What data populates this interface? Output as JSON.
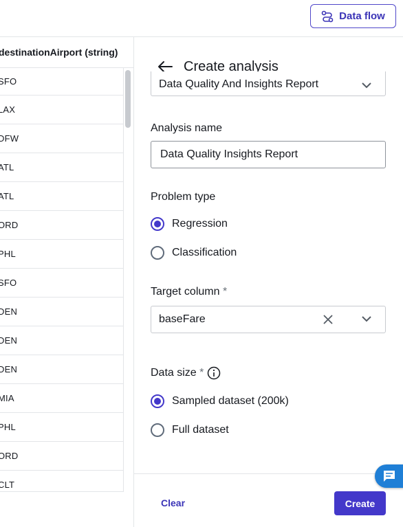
{
  "header": {
    "data_flow_label": "Data flow"
  },
  "table": {
    "column_header": "destinationAirport (string)",
    "rows": [
      "SFO",
      "LAX",
      "DFW",
      "ATL",
      "ATL",
      "ORD",
      "PHL",
      "SFO",
      "DEN",
      "DEN",
      "DEN",
      "MIA",
      "PHL",
      "ORD",
      "CLT"
    ]
  },
  "panel": {
    "title": "Create analysis",
    "analysis_type_value": "Data Quality And Insights Report",
    "analysis_name_label": "Analysis name",
    "analysis_name_value": "Data Quality Insights Report",
    "problem_type_label": "Problem type",
    "problem_type_options": [
      "Regression",
      "Classification"
    ],
    "problem_type_selected": "Regression",
    "target_column_label": "Target column",
    "target_column_value": "baseFare",
    "data_size_label": "Data size",
    "data_size_options": [
      "Sampled dataset (200k)",
      "Full dataset"
    ],
    "data_size_selected": "Sampled dataset (200k)",
    "required_mark": "*"
  },
  "footer": {
    "clear_label": "Clear",
    "create_label": "Create"
  },
  "colors": {
    "accent": "#4338ca",
    "border": "#e3e5e8",
    "chat": "#1f7fd6"
  },
  "icons": [
    "data-flow-icon",
    "back-arrow-icon",
    "chevron-down-icon",
    "clear-x-icon",
    "info-icon",
    "chat-icon"
  ]
}
